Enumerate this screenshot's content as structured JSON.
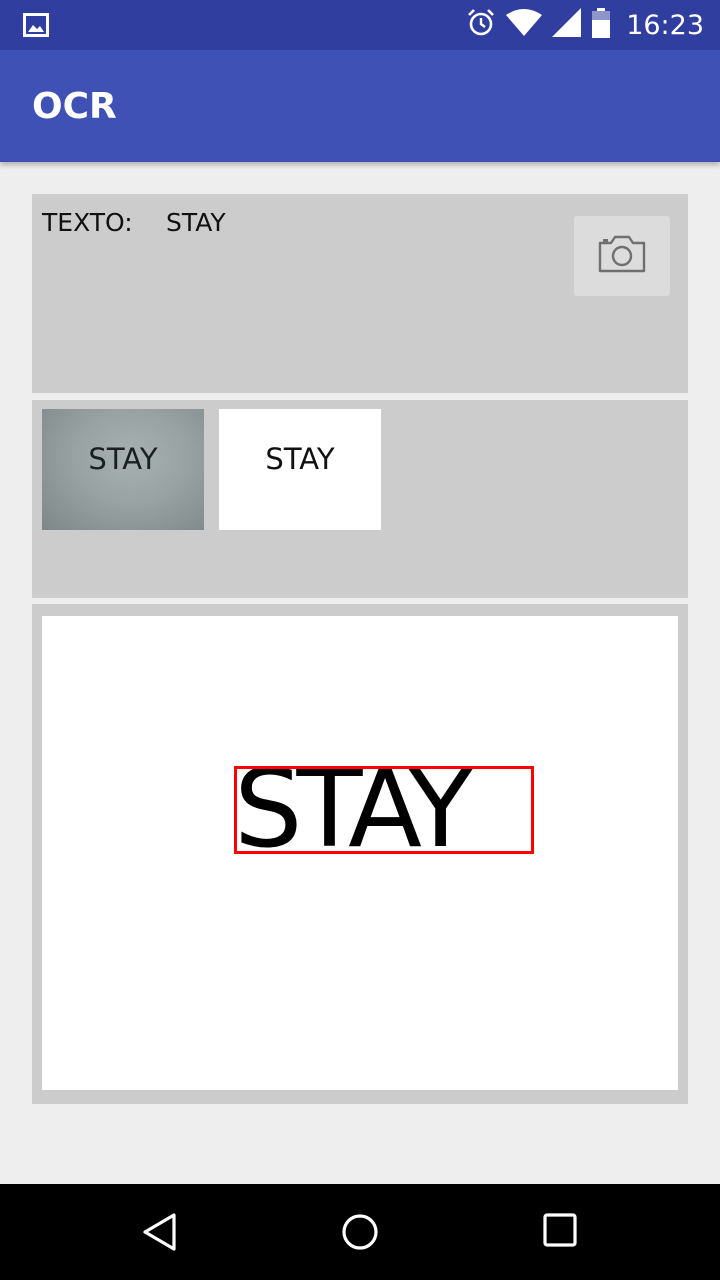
{
  "status_bar": {
    "time": "16:23",
    "icons": [
      "image-notification-icon",
      "alarm-icon",
      "wifi-icon",
      "signal-icon",
      "battery-icon"
    ]
  },
  "app_bar": {
    "title": "OCR"
  },
  "result_panel": {
    "label": "TEXTO:",
    "value": "STAY"
  },
  "thumbnails": {
    "original_text": "STAY",
    "processed_text": "STAY"
  },
  "detection": {
    "text": "STAY",
    "box_color": "#ff0000"
  },
  "colors": {
    "status_bar": "#303f9f",
    "app_bar": "#3f51b5",
    "panel": "#cccccc",
    "background": "#eeeeee"
  },
  "nav_bar": {
    "buttons": [
      "back-icon",
      "home-icon",
      "recents-icon"
    ]
  }
}
